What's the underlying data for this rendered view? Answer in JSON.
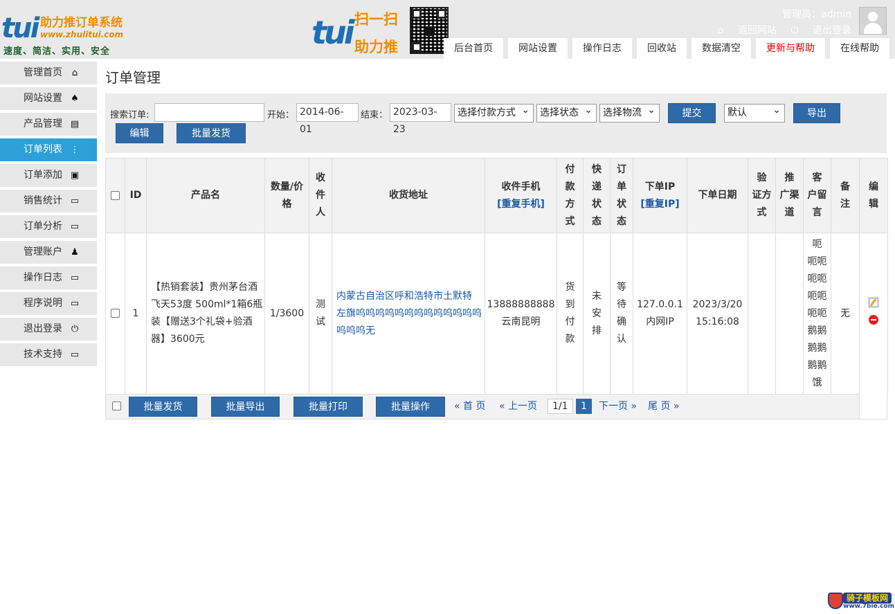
{
  "header": {
    "logo": {
      "mark": "tui",
      "brand": "助力推订单系统",
      "url": "www.zhulitui.com",
      "slogan": "速度、简洁、实用、安全"
    },
    "promo": {
      "mark": "tui",
      "scan": "扫一扫",
      "push": "助力推"
    },
    "user": {
      "label": "管理员：admin",
      "back_link": "返回网站",
      "logout_link": "退出登录"
    },
    "nav": [
      "后台首页",
      "网站设置",
      "操作日志",
      "回收站",
      "数据清空",
      "更新与帮助",
      "在线帮助"
    ]
  },
  "sidebar": {
    "items": [
      {
        "label": "管理首页",
        "icon": "home-icon",
        "glyph": "⌂"
      },
      {
        "label": "网站设置",
        "icon": "settings-icon",
        "glyph": "♠"
      },
      {
        "label": "产品管理",
        "icon": "print-icon",
        "glyph": "▤"
      },
      {
        "label": "订单列表",
        "icon": "list-icon",
        "glyph": "⋮"
      },
      {
        "label": "订单添加",
        "icon": "file-add-icon",
        "glyph": "▣"
      },
      {
        "label": "销售统计",
        "icon": "window-icon",
        "glyph": "▭"
      },
      {
        "label": "订单分析",
        "icon": "window-icon",
        "glyph": "▭"
      },
      {
        "label": "管理账户",
        "icon": "user-icon",
        "glyph": "♟"
      },
      {
        "label": "操作日志",
        "icon": "window-icon",
        "glyph": "▭"
      },
      {
        "label": "程序说明",
        "icon": "window-icon",
        "glyph": "▭"
      },
      {
        "label": "退出登录",
        "icon": "power-icon",
        "glyph": "⏻"
      },
      {
        "label": "技术支持",
        "icon": "window-icon",
        "glyph": "▭"
      }
    ],
    "active_index": 3
  },
  "page": {
    "title": "订单管理"
  },
  "filters": {
    "search_label": "搜索订单:",
    "search_value": "",
    "start_label": "开始：",
    "start_value": "2014-06-01",
    "end_label": "结束：",
    "end_value": "2023-03-23",
    "payment_select": "选择付款方式",
    "status_select": "选择状态",
    "logistics_select": "选择物流",
    "submit_button": "提交",
    "sort_select": "默认",
    "export_button": "导出",
    "edit_button": "编辑",
    "batch_ship_button": "批量发货"
  },
  "table": {
    "headers": {
      "id": "ID",
      "product": "产品名",
      "qty": [
        "数量/价",
        "格"
      ],
      "receiver": [
        "收",
        "件",
        "人"
      ],
      "address": "收货地址",
      "phone": "收件手机",
      "phone_dup": "[重复手机]",
      "pay": [
        "付",
        "款",
        "方",
        "式"
      ],
      "ship": [
        "快",
        "递",
        "状",
        "态"
      ],
      "order_status": [
        "订",
        "单",
        "状",
        "态"
      ],
      "ip": "下单IP",
      "ip_dup": "[重复IP]",
      "date": "下单日期",
      "verify": [
        "验",
        "证方",
        "式"
      ],
      "channel": [
        "推",
        "广渠",
        "道"
      ],
      "message": [
        "客",
        "户留",
        "言"
      ],
      "note": [
        "备",
        "注"
      ],
      "edit": [
        "编",
        "辑"
      ]
    },
    "rows": [
      {
        "id": "1",
        "product_lines": [
          "【热销套装】贵州茅台酒",
          "飞天53度 500ml*1箱6瓶",
          "装【赠送3个礼袋+验酒",
          "器】3600元"
        ],
        "qty_price": "1/3600",
        "receiver_lines": [
          "测",
          "试"
        ],
        "address_lines": [
          "内蒙古自治区呼和浩特市土默特",
          "左旗呜呜呜呜呜呜呜呜呜呜呜呜呜",
          "呜呜呜无"
        ],
        "phone": "13888888888",
        "city": "云南昆明",
        "pay_lines": [
          "货",
          "到",
          "付",
          "款"
        ],
        "ship_lines": [
          "未",
          "安",
          "排"
        ],
        "status_lines": [
          "等",
          "待",
          "确",
          "认"
        ],
        "ip": "127.0.0.1",
        "ip_location": "内网IP",
        "date": "2023/3/20",
        "time": "15:16:08",
        "verify": "",
        "channel": "",
        "message_lines": [
          "呃",
          "呃呃",
          "呃呃",
          "呃呃",
          "呃呃",
          "鹅鹅",
          "鹅鹅",
          "鹅鹅",
          "饿"
        ],
        "note": "无"
      }
    ]
  },
  "footer": {
    "batch_ship": "批量发货",
    "batch_export": "批量导出",
    "batch_print": "批量打印",
    "batch_op": "批量操作",
    "first": "« 首 页",
    "prev": "« 上一页",
    "page_info": "1/1",
    "current_page": "1",
    "next": "下一页 »",
    "last": "尾 页 »"
  },
  "watermark": {
    "name": "骑子模板网",
    "url": "www.7bie.com"
  }
}
